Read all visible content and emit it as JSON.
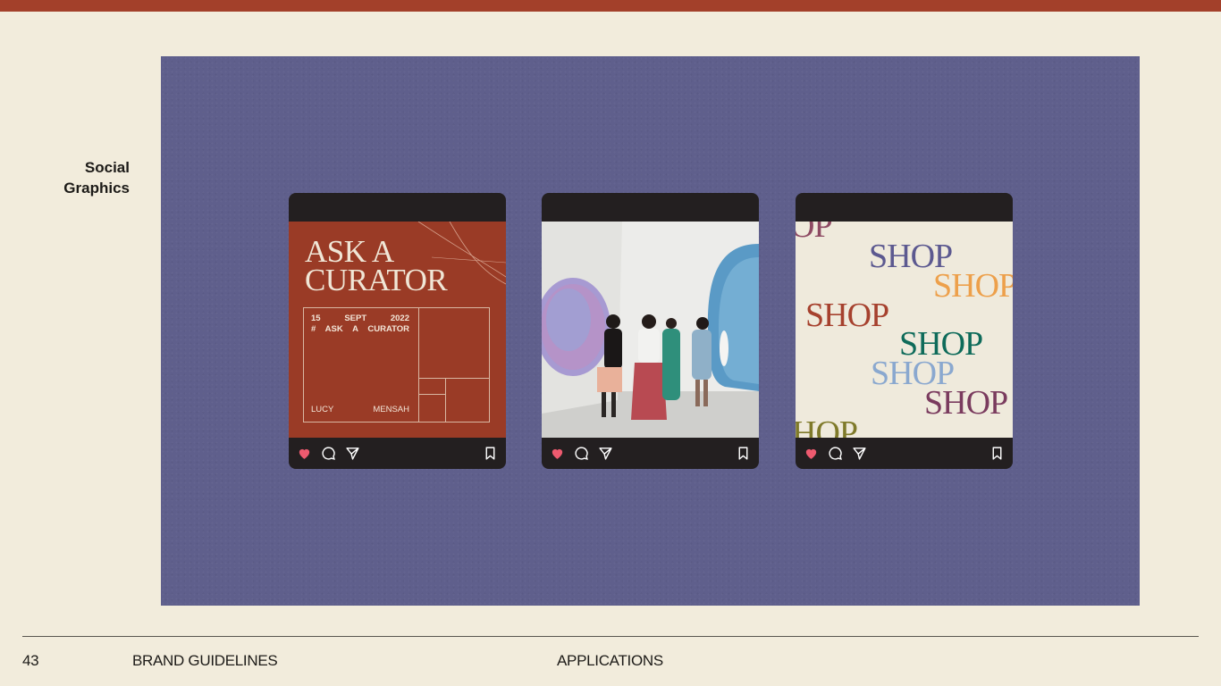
{
  "section": {
    "line1": "Social",
    "line2": "Graphics"
  },
  "card1": {
    "title_line1": "ASK A",
    "title_line2": "CURATOR",
    "date_day": "15",
    "date_month": "SEPT",
    "date_year": "2022",
    "tag_hash": "#",
    "tag_w1": "ASK",
    "tag_w2": "A",
    "tag_w3": "CURATOR",
    "name_first": "LUCY",
    "name_last": "MENSAH"
  },
  "card3": {
    "words": [
      "OP",
      "SHOP",
      "SHOP",
      "SHOP",
      "SHOP",
      "SHOP",
      "SHOP",
      "HOP"
    ]
  },
  "colors": {
    "brand_red": "#a3402a",
    "panel": "#5f5f8c",
    "like": "#ee5a6f"
  },
  "icons": [
    "heart-icon",
    "comment-icon",
    "share-icon",
    "bookmark-icon"
  ],
  "footer": {
    "page_number": "43",
    "doc_title": "BRAND GUIDELINES",
    "section": "APPLICATIONS"
  }
}
